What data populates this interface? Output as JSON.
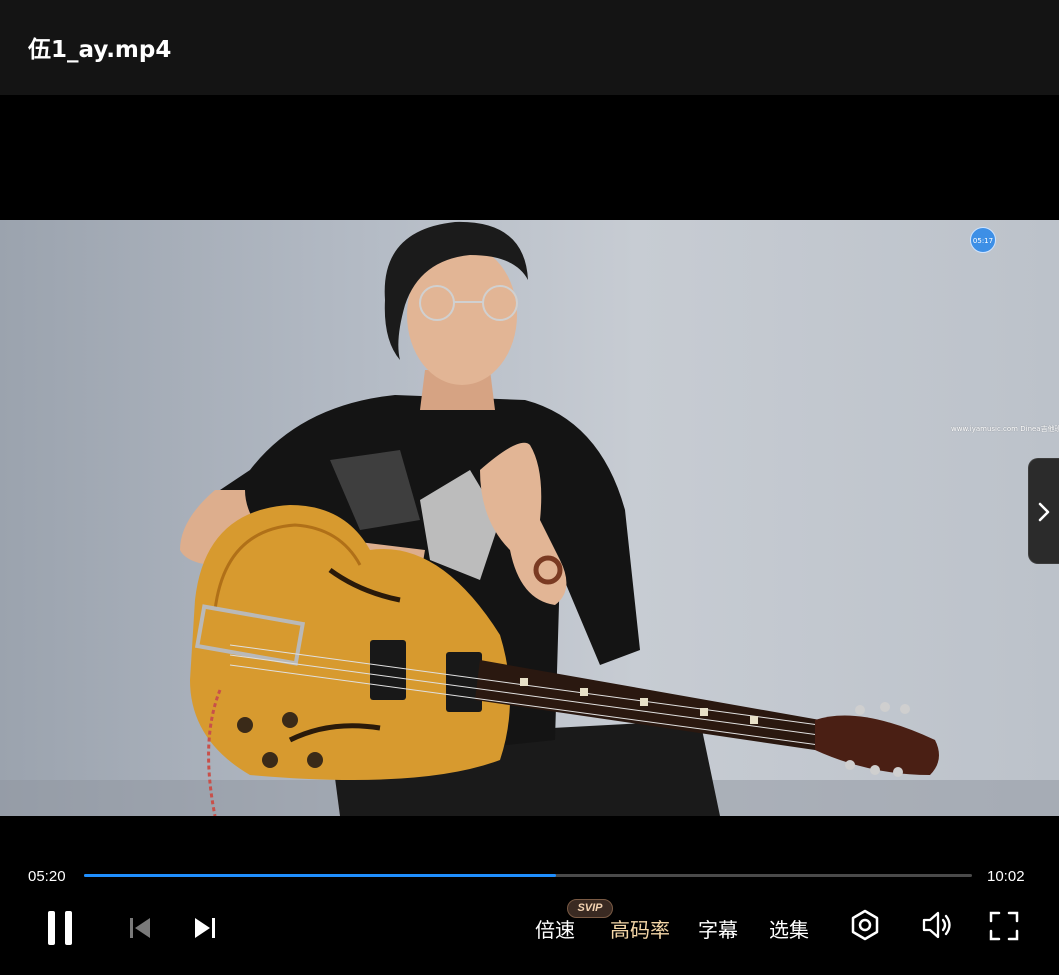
{
  "window": {
    "title": "伍1_ay.mp4"
  },
  "video": {
    "overlay_time": "05:17",
    "watermark": "www.iyamusic.com Dinea吉他班"
  },
  "player": {
    "current_time": "05:20",
    "total_time": "10:02",
    "progress_fraction": 0.532,
    "accent_color": "#1f8fff",
    "controls": {
      "play_pause_icon": "pause-icon",
      "prev_icon": "skip-previous-icon",
      "next_icon": "skip-next-icon",
      "speed_label": "倍速",
      "svip_badge": "SVIP",
      "hd_label": "高码率",
      "subtitle_label": "字幕",
      "episodes_label": "选集",
      "settings_icon": "settings-icon",
      "volume_icon": "volume-icon",
      "fullscreen_icon": "fullscreen-icon"
    },
    "side_panel_icon": "chevron-right-icon"
  }
}
